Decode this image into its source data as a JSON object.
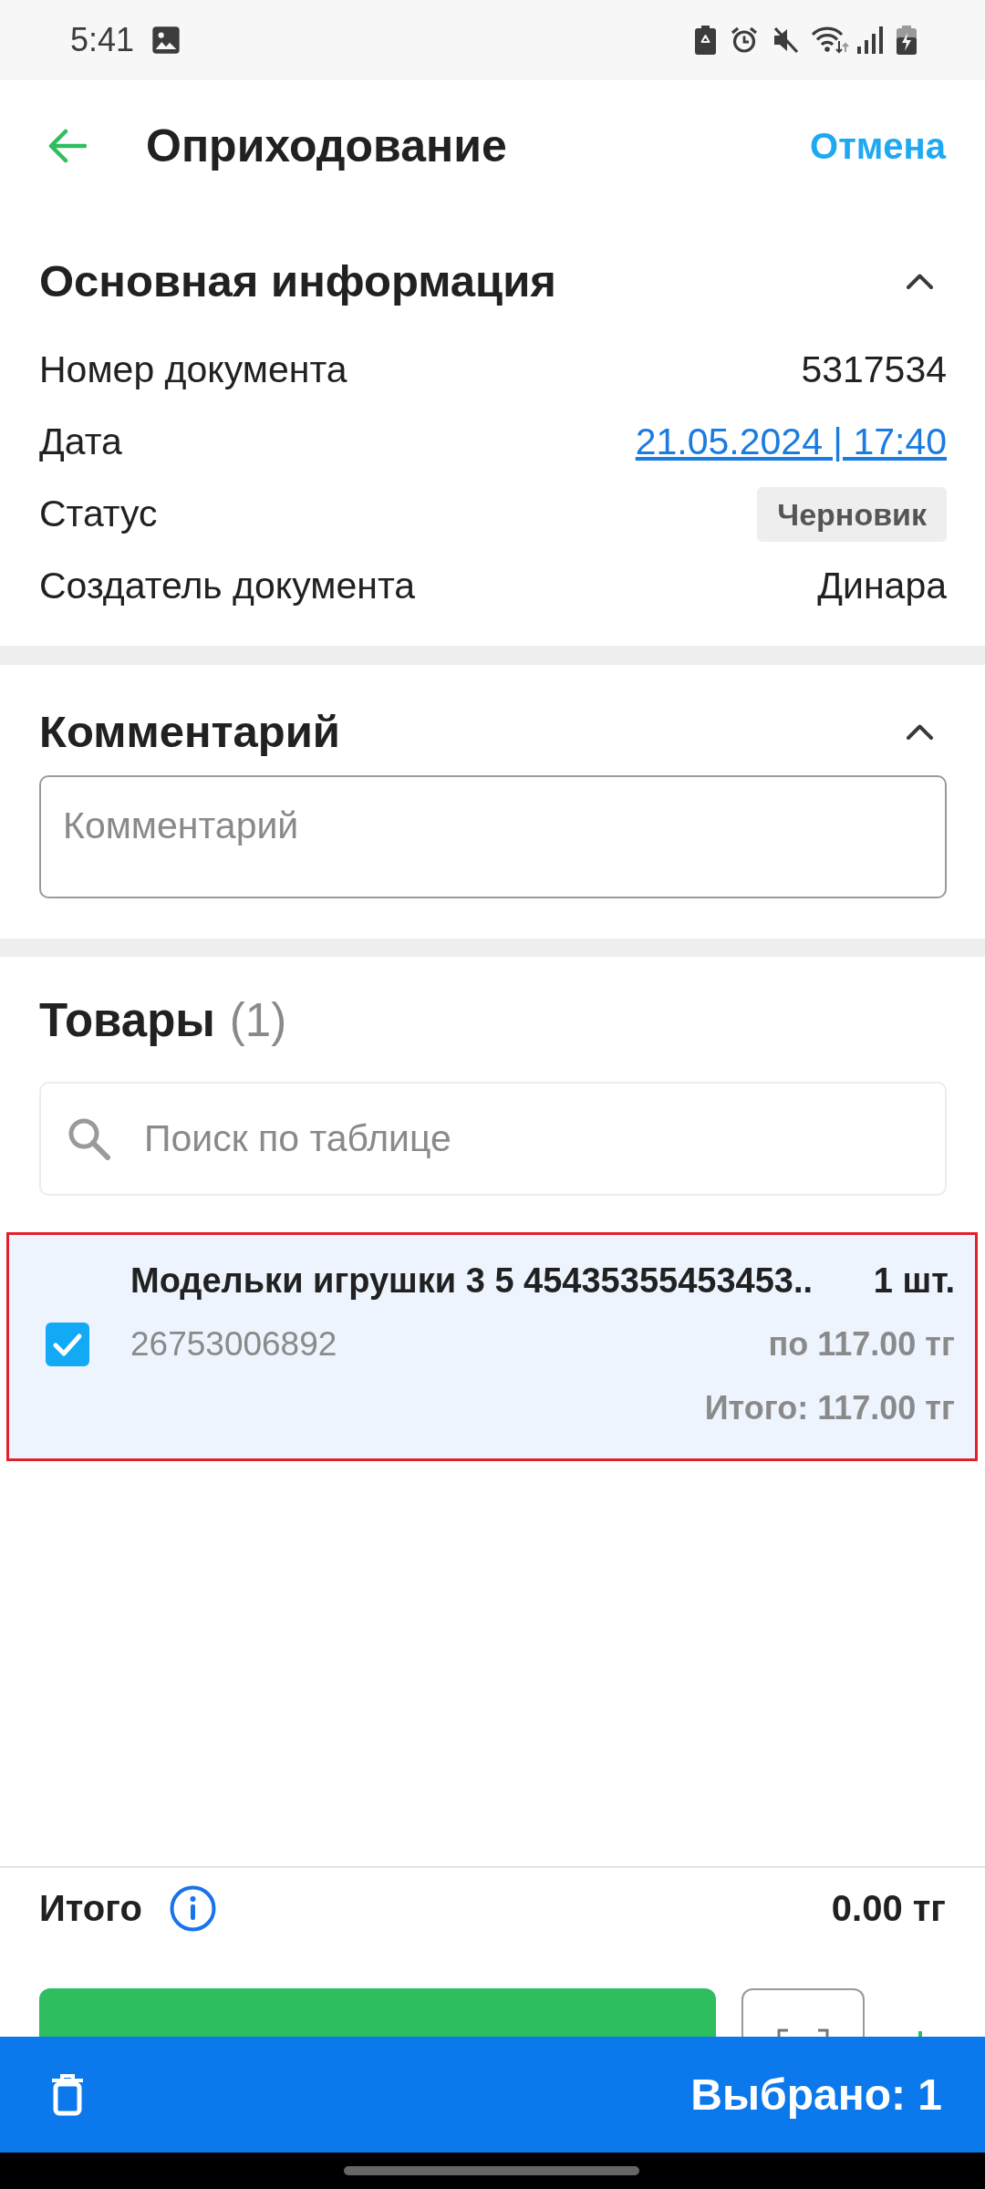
{
  "status_bar": {
    "time": "5:41"
  },
  "app_bar": {
    "title": "Оприходование",
    "action": "Отмена"
  },
  "main_info": {
    "title": "Основная информация",
    "expanded": true,
    "rows": [
      {
        "label": "Номер документа",
        "value": "5317534",
        "kind": "text"
      },
      {
        "label": "Дата",
        "value": "21.05.2024 | 17:40",
        "kind": "link"
      },
      {
        "label": "Статус",
        "value": "Черновик",
        "kind": "chip"
      },
      {
        "label": "Создатель документа",
        "value": "Динара",
        "kind": "text"
      }
    ]
  },
  "comment": {
    "title": "Комментарий",
    "expanded": true,
    "placeholder": "Комментарий"
  },
  "goods": {
    "title": "Товары",
    "count": "(1)",
    "search": {
      "placeholder": "Поиск по таблице"
    },
    "items": [
      {
        "name": "Модельки игрушки 3 5 45435355453453..",
        "quantity": "1 шт.",
        "barcode": "26753006892",
        "price": "по 117.00 тг",
        "total": "Итого: 117.00 тг",
        "checked": true,
        "selected": true,
        "highlighted": true
      }
    ]
  },
  "footer": {
    "total_label": "Итого",
    "total_value": "0.00 тг"
  },
  "selection_bar": {
    "label": "Выбрано: 1"
  }
}
